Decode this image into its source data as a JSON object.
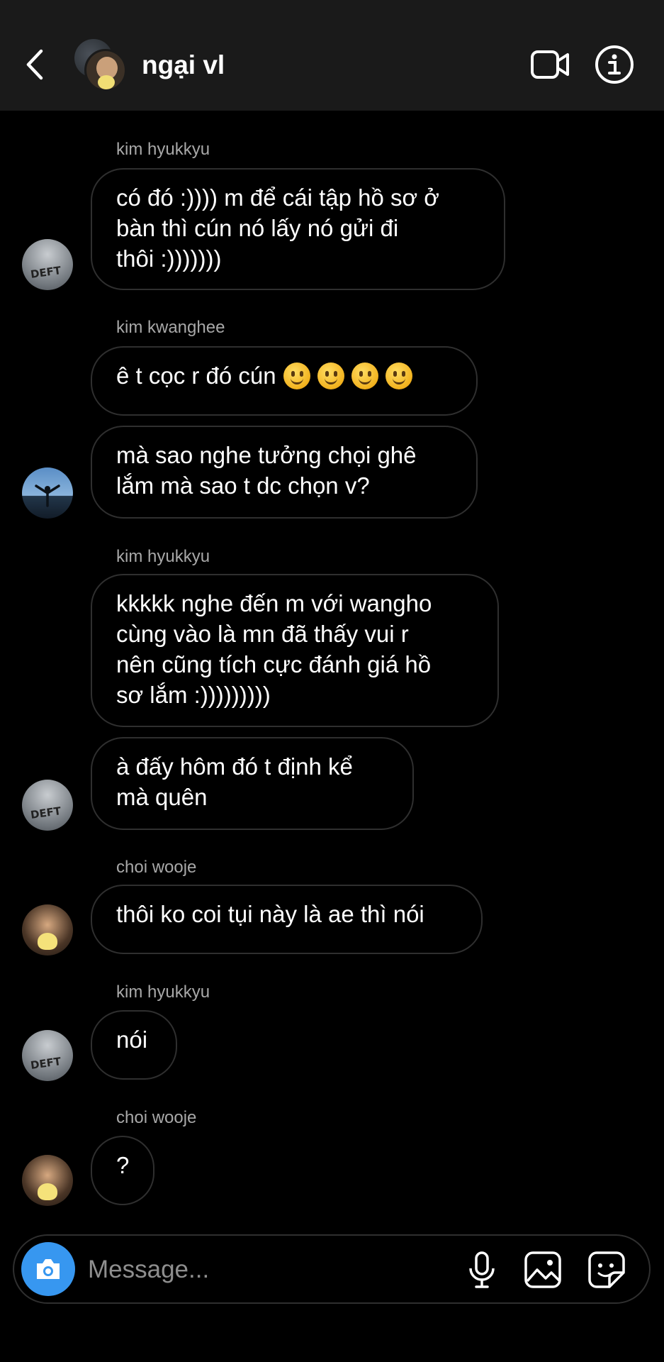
{
  "header": {
    "title": "ngại vl",
    "back_icon": "chevron-left-icon",
    "video_icon": "video-camera-icon",
    "info_icon": "info-icon"
  },
  "messages": [
    {
      "sender": "kim hyukkyu",
      "text": "có đó :)))) m để cái tập hồ sơ ở\nbàn thì cún nó lấy nó gửi đi\nthôi :)))))))"
    },
    {
      "sender": "kim kwanghee",
      "text": "ê t cọc r đó cún",
      "emoji_count": 4,
      "emoji_icon": "slightly-smiling-face-icon"
    },
    {
      "text": "mà sao nghe tưởng chọi ghê\nlắm mà sao t dc chọn v?"
    },
    {
      "sender": "kim hyukkyu",
      "text": "kkkkk nghe đến m với wangho\ncùng vào là mn đã thấy vui r\nnên cũng tích cực đánh giá hồ\nsơ lắm :)))))))))"
    },
    {
      "text": "à đấy hôm đó t định kể\nmà quên"
    },
    {
      "sender": "choi wooje",
      "text": "thôi ko coi tụi này là ae thì nói"
    },
    {
      "sender": "kim hyukkyu",
      "text": "nói"
    },
    {
      "sender": "choi wooje",
      "text": "?"
    }
  ],
  "composer": {
    "placeholder": "Message...",
    "camera_icon": "camera-icon",
    "mic_icon": "microphone-icon",
    "gallery_icon": "image-icon",
    "sticker_icon": "sticker-icon",
    "camera_color": "#3797f0"
  }
}
